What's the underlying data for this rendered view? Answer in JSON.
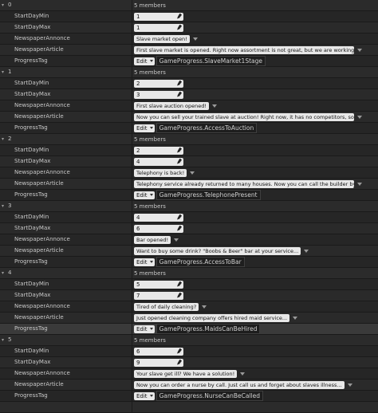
{
  "labels": {
    "start_min": "StartDayMin",
    "start_max": "StartDayMax",
    "annonce": "NewspaperAnnonce",
    "article": "NewspaperArticle",
    "progress": "ProgressTag",
    "edit": "Edit"
  },
  "items": [
    {
      "index": "0",
      "members": "5 members",
      "min": "1",
      "max": "1",
      "annonce": "Slave market open!",
      "article": "First slave market is opened. Right now assortment is not great, but we are working on increasing it...",
      "tag": "GameProgress.SlaveMarket1Stage"
    },
    {
      "index": "1",
      "members": "5 members",
      "min": "2",
      "max": "3",
      "annonce": "First slave auction opened!",
      "article": "Now you can sell your trained slave at auction! Right now, it has no competitors, so the prices here are hig!",
      "tag": "GameProgress.AccessToAuction"
    },
    {
      "index": "2",
      "members": "5 members",
      "min": "2",
      "max": "4",
      "annonce": "Telephony is back!",
      "article": "Telephony service already returned to many houses. Now you can call the builder by phone...",
      "tag": "GameProgress.TelephonePresent"
    },
    {
      "index": "3",
      "members": "5 members",
      "min": "4",
      "max": "6",
      "annonce": "Bar opened!",
      "article": "Want to buy some drink? \"Boobs & Beer\" bar at your service...",
      "tag": "GameProgress.AccessToBar"
    },
    {
      "index": "4",
      "members": "5 members",
      "min": "5",
      "max": "7",
      "annonce": "Tired of daily cleaning?",
      "article": "Just opened cleaning company offers hired maid service...",
      "tag": "GameProgress.MaidsCanBeHired"
    },
    {
      "index": "5",
      "members": "5 members",
      "min": "6",
      "max": "9",
      "annonce": "Your slave get ill? We have a solution!",
      "article": "Now you can order a nurse by call. Just call us and forget about slaves illness...",
      "tag": "GameProgress.NurseCanBeCalled"
    }
  ]
}
